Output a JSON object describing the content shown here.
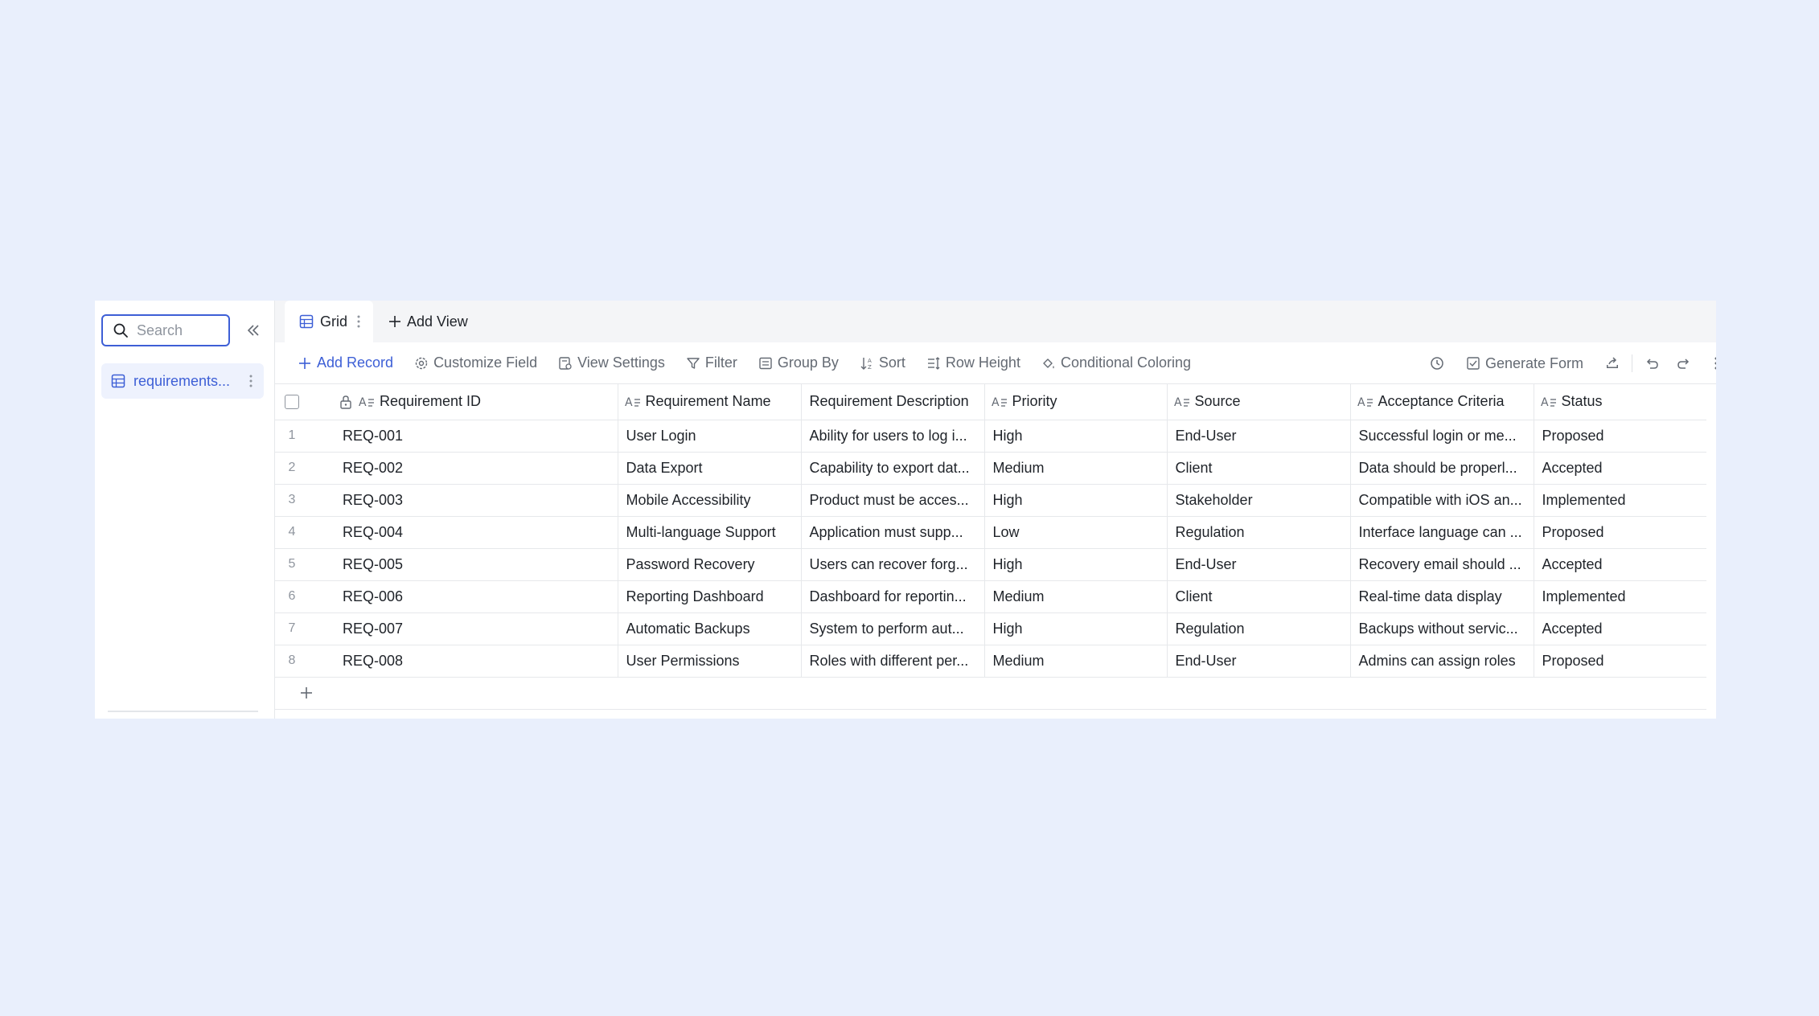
{
  "sidebar": {
    "search_placeholder": "Search",
    "table_item_label": "requirements..."
  },
  "views": {
    "active_tab_label": "Grid",
    "add_view_label": "Add View"
  },
  "toolbar": {
    "add_record": "Add Record",
    "customize_field": "Customize Field",
    "view_settings": "View Settings",
    "filter": "Filter",
    "group_by": "Group By",
    "sort": "Sort",
    "row_height": "Row Height",
    "conditional_coloring": "Conditional Coloring",
    "generate_form": "Generate Form"
  },
  "columns": [
    "Requirement ID",
    "Requirement Name",
    "Requirement Description",
    "Priority",
    "Source",
    "Acceptance Criteria",
    "Status"
  ],
  "rows": [
    {
      "n": "1",
      "id": "REQ-001",
      "name": "User Login",
      "desc": "Ability for users to log i...",
      "priority": "High",
      "source": "End-User",
      "criteria": "Successful login or me...",
      "status": "Proposed"
    },
    {
      "n": "2",
      "id": "REQ-002",
      "name": "Data Export",
      "desc": "Capability to export dat...",
      "priority": "Medium",
      "source": "Client",
      "criteria": "Data should be properl...",
      "status": "Accepted"
    },
    {
      "n": "3",
      "id": "REQ-003",
      "name": "Mobile Accessibility",
      "desc": "Product must be acces...",
      "priority": "High",
      "source": "Stakeholder",
      "criteria": "Compatible with iOS an...",
      "status": "Implemented"
    },
    {
      "n": "4",
      "id": "REQ-004",
      "name": "Multi-language Support",
      "desc": "Application must supp...",
      "priority": "Low",
      "source": "Regulation",
      "criteria": "Interface language can ...",
      "status": "Proposed"
    },
    {
      "n": "5",
      "id": "REQ-005",
      "name": "Password Recovery",
      "desc": "Users can recover forg...",
      "priority": "High",
      "source": "End-User",
      "criteria": "Recovery email should ...",
      "status": "Accepted"
    },
    {
      "n": "6",
      "id": "REQ-006",
      "name": "Reporting Dashboard",
      "desc": "Dashboard for reportin...",
      "priority": "Medium",
      "source": "Client",
      "criteria": "Real-time data display",
      "status": "Implemented"
    },
    {
      "n": "7",
      "id": "REQ-007",
      "name": "Automatic Backups",
      "desc": "System to perform aut...",
      "priority": "High",
      "source": "Regulation",
      "criteria": "Backups without servic...",
      "status": "Accepted"
    },
    {
      "n": "8",
      "id": "REQ-008",
      "name": "User Permissions",
      "desc": "Roles with different per...",
      "priority": "Medium",
      "source": "End-User",
      "criteria": "Admins can assign roles",
      "status": "Proposed"
    }
  ],
  "colors": {
    "accent": "#3d5fd6",
    "page_bg": "#e9effc",
    "muted_text": "#646a73"
  },
  "icons": [
    "search-icon",
    "collapse-left-icon",
    "table-icon",
    "more-vertical-icon",
    "plus-icon",
    "gear-icon",
    "view-settings-icon",
    "filter-icon",
    "group-by-icon",
    "sort-icon",
    "row-height-icon",
    "paint-bucket-icon",
    "history-icon",
    "form-icon",
    "share-icon",
    "undo-icon",
    "redo-icon",
    "lock-icon",
    "text-field-icon"
  ]
}
